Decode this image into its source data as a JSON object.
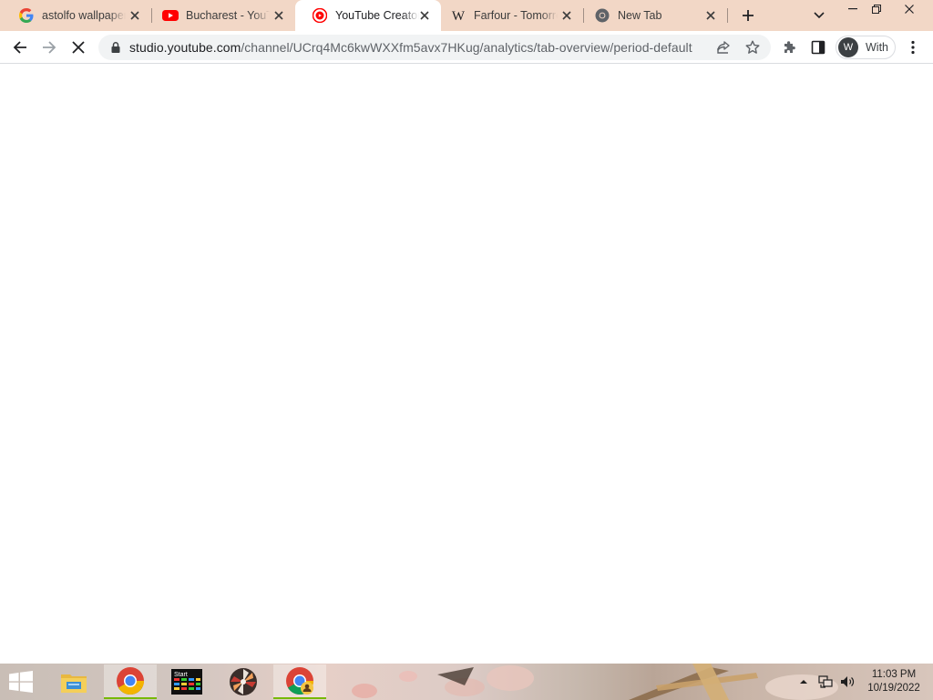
{
  "browser": {
    "tabs": [
      {
        "title": "astolfo wallpaper",
        "favicon": "google-icon",
        "active": false
      },
      {
        "title": "Bucharest - YouTube",
        "favicon": "youtube-icon",
        "active": false
      },
      {
        "title": "YouTube Creator Studio",
        "favicon": "youtube-studio-icon",
        "active": true
      },
      {
        "title": "Farfour - Tomorrow's Pioneers",
        "favicon": "wikipedia-icon",
        "active": false
      },
      {
        "title": "New Tab",
        "favicon": "chrome-icon",
        "active": false
      }
    ],
    "url": {
      "host": "studio.youtube.com",
      "path": "/channel/UCrq4Mc6kwWXXfm5avx7HKug/analytics/tab-overview/period-default"
    },
    "profile": {
      "initial": "W",
      "name": "With"
    },
    "loading": true
  },
  "taskbar": {
    "apps": [
      "chrome-icon",
      "app-grid-icon",
      "pinwheel-app-icon",
      "chrome-profile-icon"
    ],
    "start_tile_label": "Start",
    "clock": {
      "time": "11:03 PM",
      "date": "10/19/2022"
    }
  },
  "colors": {
    "tabstrip": "#f2d7c6",
    "toolbar": "#ffffff",
    "omnibox": "#f1f3f4",
    "youtube_red": "#ff0000"
  }
}
